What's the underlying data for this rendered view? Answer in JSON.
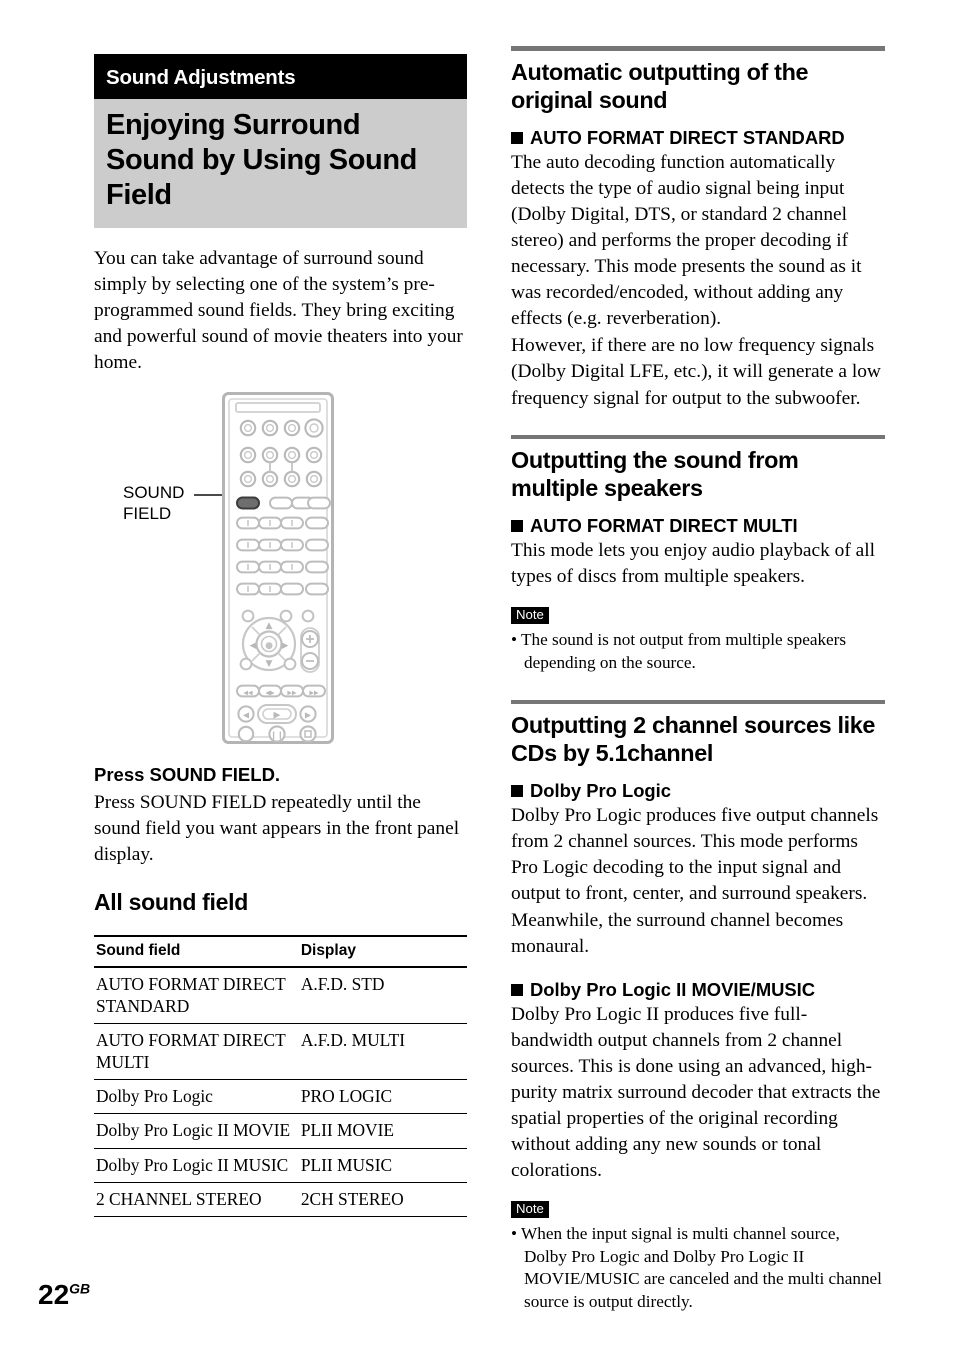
{
  "page": {
    "number": "22",
    "region_suffix": "GB"
  },
  "left": {
    "chapter": "Sound Adjustments",
    "title": "Enjoying Surround Sound by Using Sound Field",
    "intro": "You can take advantage of surround sound simply by selecting one of the system’s pre-programmed sound fields. They bring exciting and powerful sound of movie theaters into your home.",
    "figure": {
      "callout_label_line1": "SOUND",
      "callout_label_line2": "FIELD",
      "device": "remote-control"
    },
    "press_heading": "Press SOUND FIELD.",
    "press_body": "Press SOUND FIELD repeatedly until the sound field you want appears in the front panel display.",
    "table_heading": "All sound field",
    "table": {
      "columns": [
        "Sound field",
        "Display"
      ],
      "rows": [
        [
          "AUTO FORMAT DIRECT STANDARD",
          "A.F.D. STD"
        ],
        [
          "AUTO FORMAT DIRECT MULTI",
          "A.F.D. MULTI"
        ],
        [
          "Dolby Pro Logic",
          "PRO LOGIC"
        ],
        [
          "Dolby Pro Logic II MOVIE",
          "PLII MOVIE"
        ],
        [
          "Dolby Pro Logic II MUSIC",
          "PLII MUSIC"
        ],
        [
          "2 CHANNEL STEREO",
          "2CH STEREO"
        ]
      ]
    }
  },
  "right": {
    "sections": [
      {
        "title": "Automatic outputting of the original sound",
        "mode_head": "AUTO FORMAT DIRECT STANDARD",
        "paragraphs": [
          "The auto decoding function automatically detects the type of audio signal being input (Dolby Digital, DTS, or standard 2 channel stereo) and performs the proper decoding if necessary. This mode presents the sound as it was recorded/encoded, without adding any effects (e.g. reverberation).",
          "However, if there are no low frequency signals (Dolby Digital LFE, etc.), it will generate a low frequency signal for output to the subwoofer."
        ]
      },
      {
        "title": "Outputting the sound from multiple speakers",
        "mode_head": "AUTO FORMAT DIRECT MULTI",
        "paragraphs": [
          "This mode lets you enjoy audio playback of all types of discs from multiple speakers."
        ],
        "note": {
          "badge": "Note",
          "items": [
            "• The sound is not output from multiple speakers depending on the source."
          ]
        }
      },
      {
        "title": "Outputting 2 channel sources like CDs by 5.1channel",
        "mode_head": "Dolby Pro Logic",
        "paragraphs": [
          "Dolby Pro Logic produces five output channels from 2 channel sources. This mode performs Pro Logic decoding to the input signal and output to front, center, and surround speakers. Meanwhile, the surround channel becomes monaural."
        ],
        "mode_head_2": "Dolby Pro Logic II MOVIE/MUSIC",
        "paragraphs_2": [
          "Dolby Pro Logic II produces five full-bandwidth output channels from 2 channel sources. This is done using an advanced, high-purity matrix surround decoder that extracts the spatial properties of the original recording without adding any new sounds or tonal colorations."
        ],
        "note": {
          "badge": "Note",
          "items": [
            "• When the input signal is multi channel source, Dolby Pro Logic and Dolby Pro Logic II MOVIE/MUSIC are canceled and the multi channel source is output directly."
          ]
        }
      }
    ]
  },
  "colors": {
    "chapter_band": "#000000",
    "title_band": "#cccccc",
    "section_rule": "#767676",
    "remote_outline": "#b4b4b4",
    "highlight_button": "#6e6e6e"
  }
}
